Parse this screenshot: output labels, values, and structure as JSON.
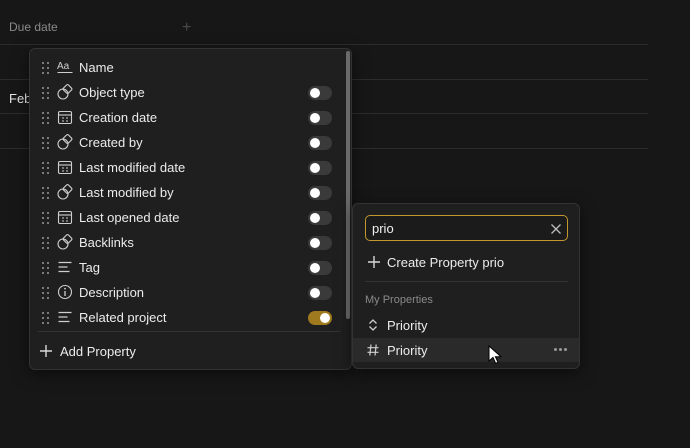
{
  "table": {
    "header": {
      "due_date": "Due date",
      "add_column": "+"
    },
    "rows": [
      {
        "cell": ""
      },
      {
        "cell": "Feb"
      },
      {
        "cell": ""
      }
    ]
  },
  "properties_panel": {
    "items": [
      {
        "label": "Name",
        "icon": "text-aa-icon",
        "toggle": null
      },
      {
        "label": "Object type",
        "icon": "relation-shapes-icon",
        "toggle": false
      },
      {
        "label": "Creation date",
        "icon": "calendar-icon",
        "toggle": false
      },
      {
        "label": "Created by",
        "icon": "relation-shapes-icon",
        "toggle": false
      },
      {
        "label": "Last modified date",
        "icon": "calendar-icon",
        "toggle": false
      },
      {
        "label": "Last modified by",
        "icon": "relation-shapes-icon",
        "toggle": false
      },
      {
        "label": "Last opened date",
        "icon": "calendar-icon",
        "toggle": false
      },
      {
        "label": "Backlinks",
        "icon": "relation-shapes-icon",
        "toggle": false
      },
      {
        "label": "Tag",
        "icon": "multi-select-lines-icon",
        "toggle": false
      },
      {
        "label": "Description",
        "icon": "info-circle-icon",
        "toggle": false
      },
      {
        "label": "Related project",
        "icon": "multi-select-lines-icon",
        "toggle": true
      }
    ],
    "add_property_label": "Add Property"
  },
  "search_panel": {
    "query": "prio",
    "create_label": "Create Property prio",
    "section_label": "My Properties",
    "results": [
      {
        "label": "Priority",
        "icon": "select-chevrons-icon"
      },
      {
        "label": "Priority",
        "icon": "hash-icon"
      }
    ]
  },
  "colors": {
    "background": "#171717",
    "panel": "#1f1f1f",
    "accent": "#c2982e",
    "toggle_on": "#a07a1e"
  }
}
